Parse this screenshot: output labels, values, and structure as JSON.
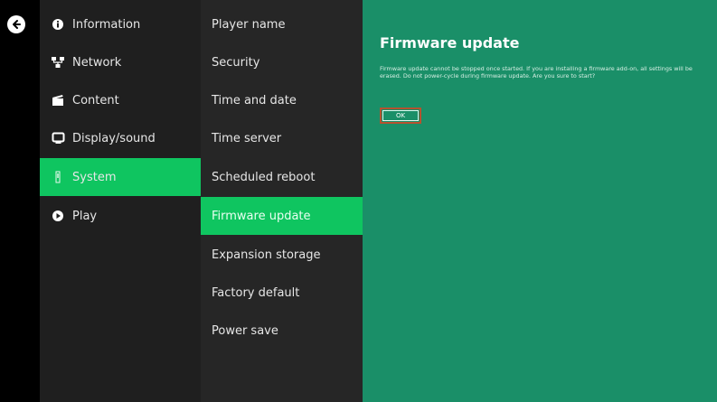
{
  "colors": {
    "accent": "#0fc560",
    "panel": "#1a8f68",
    "ok_border": "#b5522f"
  },
  "back": {
    "icon": "arrow-left-icon"
  },
  "menu": {
    "items": [
      {
        "label": "Information",
        "icon": "info-icon"
      },
      {
        "label": "Network",
        "icon": "network-icon"
      },
      {
        "label": "Content",
        "icon": "clapperboard-icon"
      },
      {
        "label": "Display/sound",
        "icon": "monitor-icon"
      },
      {
        "label": "System",
        "icon": "system-icon",
        "active": true
      },
      {
        "label": "Play",
        "icon": "play-icon"
      }
    ]
  },
  "submenu": {
    "items": [
      {
        "label": "Player name"
      },
      {
        "label": "Security"
      },
      {
        "label": "Time and date"
      },
      {
        "label": "Time server"
      },
      {
        "label": "Scheduled reboot"
      },
      {
        "label": "Firmware update",
        "active": true
      },
      {
        "label": "Expansion storage"
      },
      {
        "label": "Factory default"
      },
      {
        "label": "Power save"
      }
    ]
  },
  "panel": {
    "title": "Firmware update",
    "message": "Firmware update cannot be stopped once started. If you are installing a firmware add-on, all settings will be erased. Do not power-cycle during firmware update. Are you sure to start?",
    "ok_label": "OK"
  }
}
